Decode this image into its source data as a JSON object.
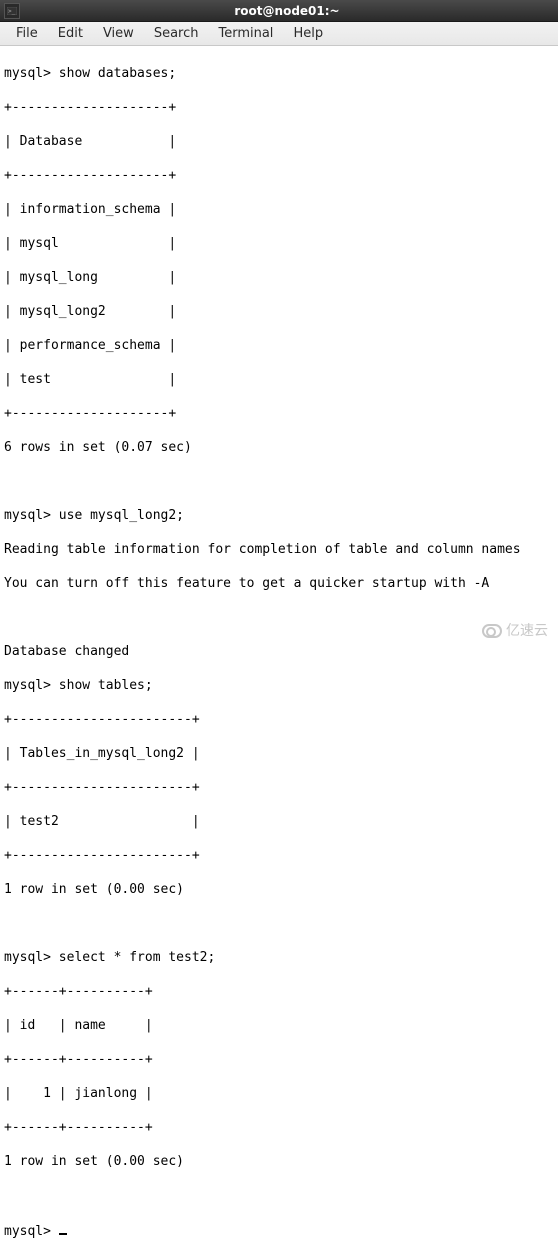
{
  "titlebar": {
    "icon_name": "terminal-icon",
    "title": "root@node01:~"
  },
  "menubar": {
    "items": [
      {
        "label": "File"
      },
      {
        "label": "Edit"
      },
      {
        "label": "View"
      },
      {
        "label": "Search"
      },
      {
        "label": "Terminal"
      },
      {
        "label": "Help"
      }
    ]
  },
  "terminal": {
    "lines": [
      "mysql> show databases;",
      "+--------------------+",
      "| Database           |",
      "+--------------------+",
      "| information_schema |",
      "| mysql              |",
      "| mysql_long         |",
      "| mysql_long2        |",
      "| performance_schema |",
      "| test               |",
      "+--------------------+",
      "6 rows in set (0.07 sec)",
      "",
      "mysql> use mysql_long2;",
      "Reading table information for completion of table and column names",
      "You can turn off this feature to get a quicker startup with -A",
      "",
      "Database changed",
      "mysql> show tables;",
      "+-----------------------+",
      "| Tables_in_mysql_long2 |",
      "+-----------------------+",
      "| test2                 |",
      "+-----------------------+",
      "1 row in set (0.00 sec)",
      "",
      "mysql> select * from test2;",
      "+------+----------+",
      "| id   | name     |",
      "+------+----------+",
      "|    1 | jianlong |",
      "+------+----------+",
      "1 row in set (0.00 sec)",
      "",
      "mysql> "
    ],
    "prompt_cursor": "_"
  },
  "watermark": {
    "text": "亿速云"
  }
}
